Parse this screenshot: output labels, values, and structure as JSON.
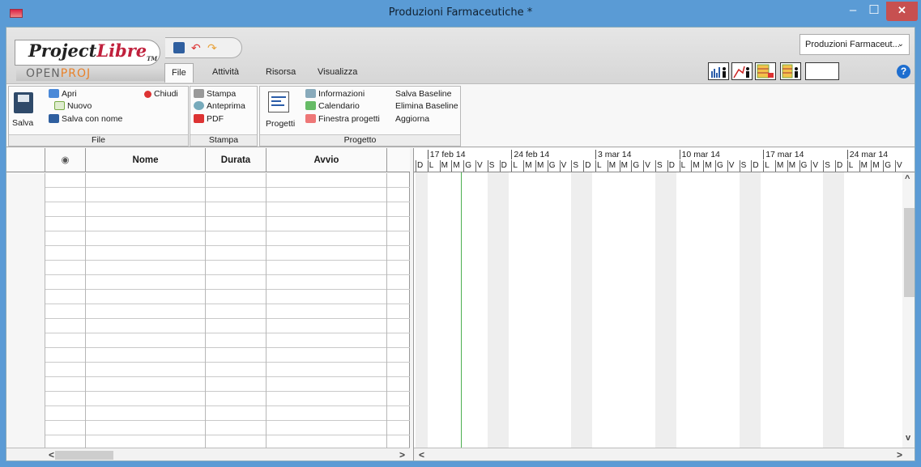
{
  "window": {
    "title": "Produzioni Farmaceutiche *",
    "min_glyph": "–",
    "max_glyph": "☐",
    "close_glyph": "✕"
  },
  "brand": {
    "logo_project": "Project",
    "logo_libre": "Libre",
    "logo_tm": "TM",
    "sub_open": "OPEN",
    "sub_proj": "PROJ"
  },
  "tabs": [
    {
      "label": "File",
      "active": true
    },
    {
      "label": "Attività"
    },
    {
      "label": "Risorsa"
    },
    {
      "label": "Visualizza"
    }
  ],
  "project_select": {
    "value": "Produzioni Farmaceut...",
    "chevron": "⌄"
  },
  "help_glyph": "?",
  "ribbon": {
    "file": {
      "label": "File",
      "save": "Salva",
      "open": "Apri",
      "new": "Nuovo",
      "close": "Chiudi",
      "save_as": "Salva con nome"
    },
    "print": {
      "label": "Stampa",
      "print": "Stampa",
      "preview": "Anteprima",
      "pdf": "PDF"
    },
    "project": {
      "label": "Progetto",
      "projects": "Progetti",
      "info": "Informazioni",
      "calendar": "Calendario",
      "project_window": "Finestra progetti",
      "save_baseline": "Salva Baseline",
      "delete_baseline": "Elimina Baseline",
      "update": "Aggiorna"
    }
  },
  "grid": {
    "columns": [
      "",
      "",
      "Nome",
      "Durata",
      "Avvio"
    ],
    "indicator_icon": "◉",
    "row_count": 19
  },
  "gantt": {
    "weeks": [
      "17 feb 14",
      "24 feb 14",
      "3 mar 14",
      "10 mar 14",
      "17 mar 14",
      "24 mar 14"
    ],
    "days": [
      "D",
      "L",
      "M",
      "M",
      "G",
      "V",
      "S",
      "D",
      "L",
      "M",
      "M",
      "G",
      "V",
      "S",
      "D",
      "L",
      "M",
      "M",
      "G",
      "V",
      "S",
      "D",
      "L",
      "M",
      "M",
      "G",
      "V",
      "S",
      "D",
      "L",
      "M",
      "M",
      "G",
      "V",
      "S",
      "D",
      "L",
      "M",
      "M",
      "G",
      "V"
    ]
  },
  "scroll": {
    "left": "<",
    "right": ">",
    "up": "^",
    "down": "v"
  },
  "colors": {
    "titlebar": "#5a9bd5",
    "close_button": "#c75050",
    "brand_red": "#c0203c",
    "today_line": "#4caf50"
  }
}
